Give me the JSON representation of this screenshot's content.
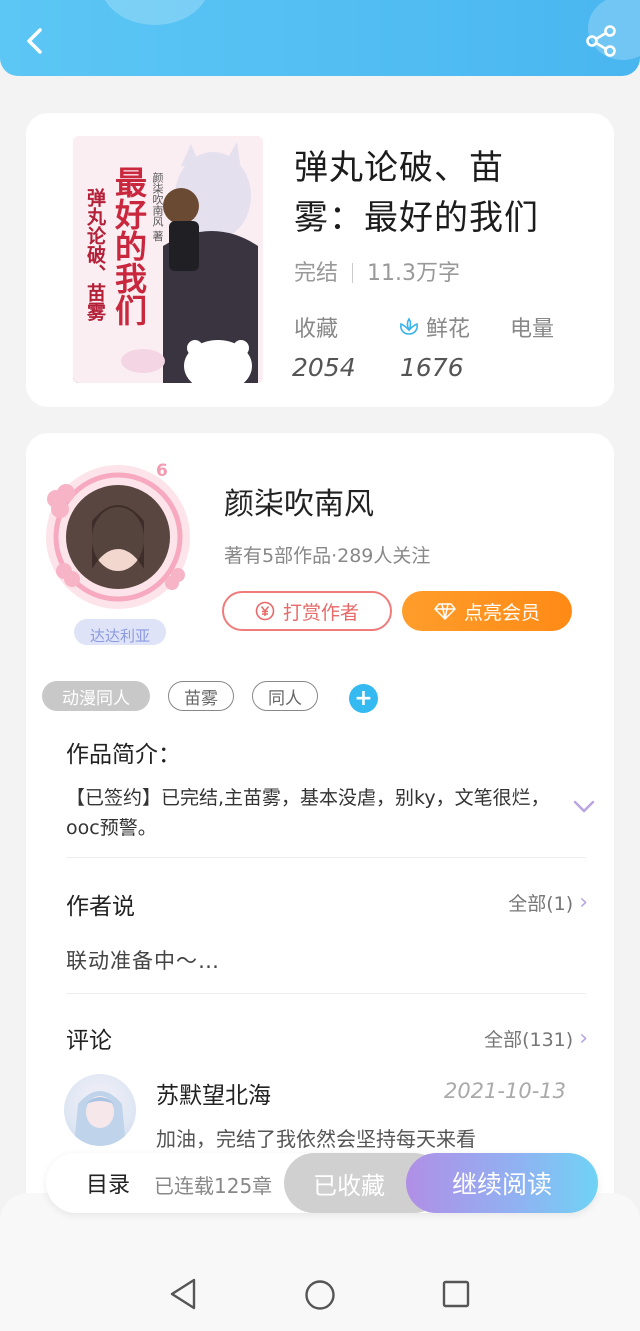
{
  "colors": {
    "header": "#49b6f0",
    "tip": "#e86a6a",
    "vip": "#ff8a16",
    "accent_blue": "#34b9f0",
    "read_gradient_start": "#b08fe6"
  },
  "header": {
    "back_icon": "chevron-left-icon",
    "share_icon": "share-icon"
  },
  "book": {
    "title_line1": "弹丸论破、苗",
    "title_line2": "雾：最好的我们",
    "status": "完结",
    "word_count": "11.3万字",
    "cover_title": "最好的我们",
    "cover_subtitle": "弹丸论破、苗雾",
    "cover_author": "颜柒吹南风 著",
    "stats": [
      {
        "label": "收藏",
        "value": "2054"
      },
      {
        "label": "鲜花",
        "value": "1676",
        "icon": "flower-icon"
      },
      {
        "label": "电量",
        "value": ""
      }
    ]
  },
  "author": {
    "name": "颜柒吹南风",
    "meta": "著有5部作品·289人关注",
    "level": "6",
    "badge": "达达利亚",
    "tip_label": "打赏作者",
    "vip_label": "点亮会员"
  },
  "tags": [
    "动漫同人",
    "苗雾",
    "同人"
  ],
  "intro": {
    "title": "作品简介：",
    "text": "【已签约】已完结,主苗雾，基本没虐，别ky，文笔很烂，ooc预警。"
  },
  "author_note": {
    "title": "作者说",
    "all_label": "全部(1)",
    "text": "联动准备中～…"
  },
  "comments": {
    "title": "评论",
    "all_label": "全部(131)",
    "items": [
      {
        "user": "苏默望北海",
        "date": "2021-10-13",
        "text": "加油，完结了我依然会坚持每天来看"
      }
    ]
  },
  "action_bar": {
    "toc_label": "目录",
    "chapters": "已连载125章",
    "collected_label": "已收藏",
    "read_label": "继续阅读"
  }
}
